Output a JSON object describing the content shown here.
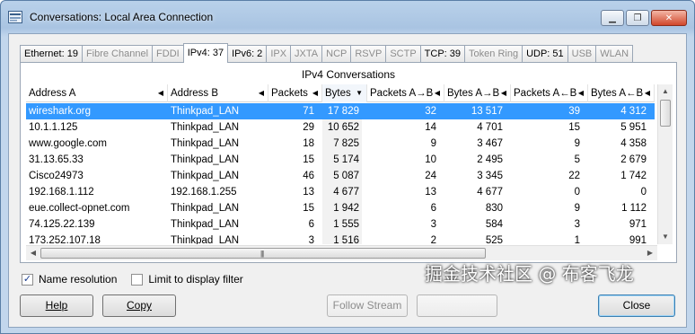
{
  "window": {
    "title": "Conversations: Local Area Connection",
    "controls": {
      "minimize": "▁",
      "maximize": "❐",
      "close": "✕"
    }
  },
  "tabs": [
    {
      "label": "Ethernet: 19",
      "enabled": true,
      "active": false
    },
    {
      "label": "Fibre Channel",
      "enabled": false,
      "active": false
    },
    {
      "label": "FDDI",
      "enabled": false,
      "active": false
    },
    {
      "label": "IPv4: 37",
      "enabled": true,
      "active": true
    },
    {
      "label": "IPv6: 2",
      "enabled": true,
      "active": false
    },
    {
      "label": "IPX",
      "enabled": false,
      "active": false
    },
    {
      "label": "JXTA",
      "enabled": false,
      "active": false
    },
    {
      "label": "NCP",
      "enabled": false,
      "active": false
    },
    {
      "label": "RSVP",
      "enabled": false,
      "active": false
    },
    {
      "label": "SCTP",
      "enabled": false,
      "active": false
    },
    {
      "label": "TCP: 39",
      "enabled": true,
      "active": false
    },
    {
      "label": "Token Ring",
      "enabled": false,
      "active": false
    },
    {
      "label": "UDP: 51",
      "enabled": true,
      "active": false
    },
    {
      "label": "USB",
      "enabled": false,
      "active": false
    },
    {
      "label": "WLAN",
      "enabled": false,
      "active": false
    }
  ],
  "panel_title": "IPv4 Conversations",
  "columns": [
    {
      "label": "Address A",
      "arrow": "◀"
    },
    {
      "label": "Address B",
      "arrow": "◀"
    },
    {
      "label": "Packets",
      "arrow": "◀"
    },
    {
      "label": "Bytes",
      "arrow": "▼"
    },
    {
      "label": "Packets A→B",
      "arrow": "◀"
    },
    {
      "label": "Bytes A→B",
      "arrow": "◀"
    },
    {
      "label": "Packets A←B",
      "arrow": "◀"
    },
    {
      "label": "Bytes A←B",
      "arrow": "◀"
    }
  ],
  "rows": [
    {
      "a": "wireshark.org",
      "b": "Thinkpad_LAN",
      "packets": "71",
      "bytes": "17 829",
      "pab": "32",
      "bab": "13 517",
      "pba": "39",
      "bba": "4 312",
      "selected": true
    },
    {
      "a": "10.1.1.125",
      "b": "Thinkpad_LAN",
      "packets": "29",
      "bytes": "10 652",
      "pab": "14",
      "bab": "4 701",
      "pba": "15",
      "bba": "5 951",
      "selected": false
    },
    {
      "a": "www.google.com",
      "b": "Thinkpad_LAN",
      "packets": "18",
      "bytes": "7 825",
      "pab": "9",
      "bab": "3 467",
      "pba": "9",
      "bba": "4 358",
      "selected": false
    },
    {
      "a": "31.13.65.33",
      "b": "Thinkpad_LAN",
      "packets": "15",
      "bytes": "5 174",
      "pab": "10",
      "bab": "2 495",
      "pba": "5",
      "bba": "2 679",
      "selected": false
    },
    {
      "a": "Cisco24973",
      "b": "Thinkpad_LAN",
      "packets": "46",
      "bytes": "5 087",
      "pab": "24",
      "bab": "3 345",
      "pba": "22",
      "bba": "1 742",
      "selected": false
    },
    {
      "a": "192.168.1.112",
      "b": "192.168.1.255",
      "packets": "13",
      "bytes": "4 677",
      "pab": "13",
      "bab": "4 677",
      "pba": "0",
      "bba": "0",
      "selected": false
    },
    {
      "a": "eue.collect-opnet.com",
      "b": "Thinkpad_LAN",
      "packets": "15",
      "bytes": "1 942",
      "pab": "6",
      "bab": "830",
      "pba": "9",
      "bba": "1 112",
      "selected": false
    },
    {
      "a": "74.125.22.139",
      "b": "Thinkpad_LAN",
      "packets": "6",
      "bytes": "1 555",
      "pab": "3",
      "bab": "584",
      "pba": "3",
      "bba": "971",
      "selected": false
    },
    {
      "a": "173.252.107.18",
      "b": "Thinkpad_LAN",
      "packets": "3",
      "bytes": "1 516",
      "pab": "2",
      "bab": "525",
      "pba": "1",
      "bba": "991",
      "selected": false
    }
  ],
  "options": {
    "name_resolution": {
      "label": "Name resolution",
      "checked": true
    },
    "limit_filter": {
      "label": "Limit to display filter",
      "checked": false
    }
  },
  "buttons": {
    "help": "Help",
    "copy": "Copy",
    "follow_stream": "Follow Stream",
    "graph": "",
    "close": "Close"
  },
  "watermark": "掘金技术社区 @ 布客飞龙",
  "colors": {
    "selection": "#3399ff",
    "title_gradient": "#b9d1ea",
    "disabled_text": "#8c8c8c"
  }
}
